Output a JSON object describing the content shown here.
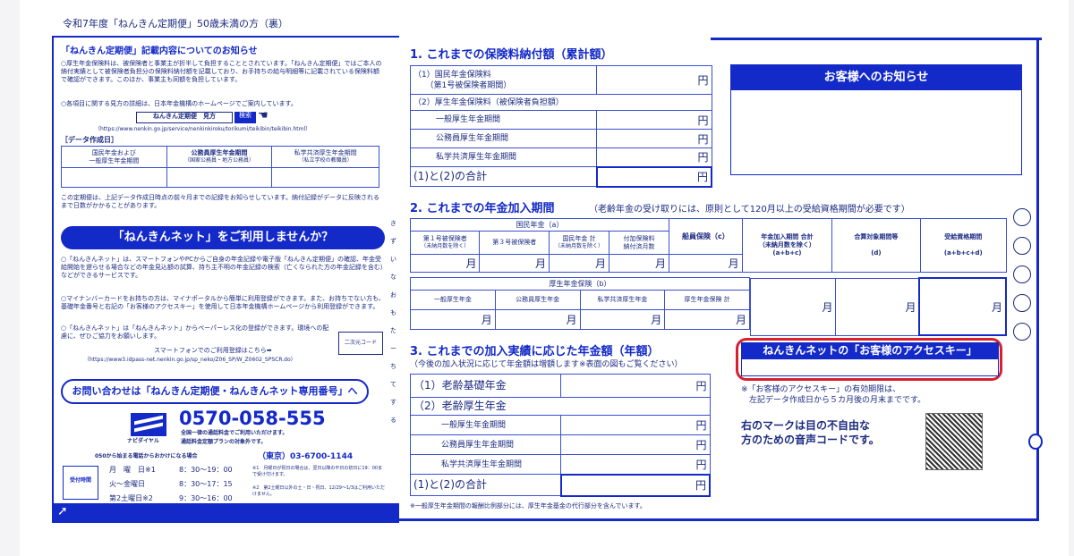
{
  "header_title": "令和7年度「ねんきん定期便」50歳未満の方（裏）",
  "left": {
    "notice_title": "「ねんきん定期便」記載内容についてのお知らせ",
    "notice_1": "○厚生年金保険料は、被保険者と事業主が折半して負担することとされています。「ねんきん定期便」ではご本人の納付実績として被保険者負担分の保険料納付額を記載しており、お手持ちの給与明細等に記載されている保険料額で確認ができます。このほか、事業主も同額を負担しています。",
    "notice_2": "○各項目に関する見方の詳細は、日本年金機構のホームページでご案内しています。",
    "search_box": "ねんきん定期便　見方",
    "search_button": "検索",
    "url_1": "（https://www.nenkin.go.jp/service/nenkinkiroku/torikumi/teikibin/teikibin.html）",
    "data_date_title": "［データ作成日］",
    "data_date_cols": [
      {
        "title": "国民年金および\n一般厚生年金期間",
        "sub": ""
      },
      {
        "title": "公務員厚生年金期間",
        "sub": "（国家公務員・地方公務員）"
      },
      {
        "title": "私学共済厚生年金期間",
        "sub": "（私立学校の教職員）"
      }
    ],
    "data_note": "この定期便は、上記データ作成日時点の前々月までの記録をお知らせしています。納付記録がデータに反映されるまで日数がかかることがあります。",
    "net_banner": "「ねんきんネット」をご利用しませんか？",
    "net_1": "○「ねんきんネット」は、スマートフォンやPCからご自身の年金記録や電子版「ねんきん定期便」の確認、年金受給開始を遅らせる場合などの年金見込額の試算、持ち主不明の年金記録の検索（亡くなられた方の年金記録を含む）などができるサービスです。",
    "net_2": "○マイナンバーカードをお持ちの方は、マイナポータルから簡単に利用登録ができます。また、お持ちでない方も、基礎年金番号と右記の「お客様のアクセスキー」を使用して日本年金機構ホームページから利用登録ができます。",
    "net_3": "○「ねんきんネット」は「ねんきんネット」からペーパーレス化の登録ができます。環境への配慮に、ぜひご協力をお願いします。",
    "qr_label": "二次元コード",
    "sp_line": "スマートフォンでのご利用登録はこちら➡",
    "url_2": "（https://www3.idpass-net.nenkin.go.jp/sp_neko/Z06_SP/W_Z0602_SPSCR.do）",
    "contact_banner": "お問い合わせは「ねんきん定期便・ねんきんネット専用番号」へ",
    "navi_label": "ナビダイヤル",
    "phone_main": "0570-058-555",
    "phone_note_1": "全国一律の通話料金でご利用いただけます。",
    "phone_note_2": "通話料金定額プランの対象外です。",
    "phone_050_label": "050から始まる電話からおかけになる場合",
    "phone_050": "（東京）03-6700-1144",
    "hours_label": "受付時間",
    "hours": [
      {
        "day": "月　曜　日※1",
        "time": "8：30～19：00"
      },
      {
        "day": "火～金曜日",
        "time": "8：30～17：15"
      },
      {
        "day": "第2土曜日※2",
        "time": "9：30～16：00"
      }
    ],
    "hours_note_1": "※1　月曜日が祝日の場合は、翌日以降の平日の初日に19：00まで受け付けます。",
    "hours_note_2": "※2　第2土曜日以外の土・日・祝日、12/29～1/3はご利用いただけません。"
  },
  "sec1": {
    "title": "1. これまでの保険料納付額（累計額）",
    "row1_label": "（1）国民年金保険料\n　　（第1号被保険者期間）",
    "row2_label": "（2）厚生年金保険料（被保険者負担額）",
    "sub_rows": [
      "一般厚生年金期間",
      "公務員厚生年金期間",
      "私学共済厚生年金期間"
    ],
    "total_label": "(1)と(2)の合計",
    "unit": "円"
  },
  "notice_box_title": "お客様へのお知らせ",
  "sec2": {
    "title": "2. これまでの年金加入期間",
    "note": "（老齢年金の受け取りには、原則として120月以上の受給資格期間が必要です）",
    "kokumin_header": "国民年金（a）",
    "cols_a": [
      {
        "t": "第１号被保険者",
        "s": "（未納月数を除く）"
      },
      {
        "t": "第３号被保険者",
        "s": ""
      },
      {
        "t": "国民年金 計",
        "s": "（未納月数を除く）"
      },
      {
        "t": "付加保険料\n納付済月数",
        "s": ""
      }
    ],
    "senin_header": "船員保険（c）",
    "kosei_header": "厚生年金保険（b）",
    "cols_b": [
      "一般厚生年金",
      "公務員厚生年金",
      "私学共済厚生年金",
      "厚生年金保険 計"
    ],
    "total_header": "年金加入期間 合計\n（未納月数を除く）\n(a+b+c)",
    "gassan_header": "合算対象期間等\n\n(d)",
    "jukyu_header": "受給資格期間\n\n(a+b+c+d)",
    "unit": "月"
  },
  "sec3": {
    "title": "3. これまでの加入実績に応じた年金額（年額）",
    "sub": "（今後の加入状況に応じて年金額は増額します※表面の図もご覧ください）",
    "row1": "（1）老齢基礎年金",
    "row2": "（2）老齢厚生年金",
    "sub_rows": [
      "一般厚生年金期間",
      "公務員厚生年金期間",
      "私学共済厚生年金期間"
    ],
    "total_label": "(1)と(2)の合計",
    "unit": "円",
    "footnote": "※一般厚生年金期間の報酬比例部分には、厚生年金基金の代行部分を含んでいます。"
  },
  "access": {
    "title": "ねんきんネットの「お客様のアクセスキー」",
    "note": "※「お客様のアクセスキー」の有効期限は、\n　左記データ作成日から５カ月後の月末までです。"
  },
  "voice": {
    "text": "右のマークは目の不自由な\n方のための音声コードです。"
  },
  "vertical_text": "き　ず　い　な　お　も　た　ー　ち　て　す　る",
  "colors": {
    "brand": "#1329c8",
    "navy": "#1b2a80",
    "highlight": "#d8202a"
  }
}
